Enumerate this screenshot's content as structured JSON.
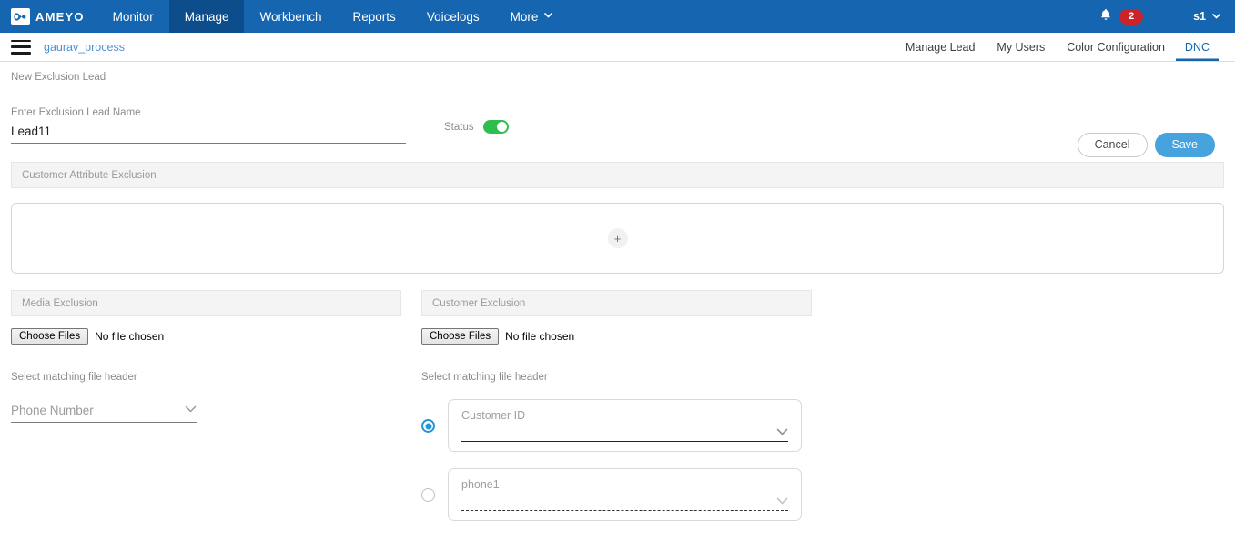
{
  "topnav": {
    "brand": "AMEYO",
    "brand_icon": "infinity-logo-icon",
    "items": [
      {
        "label": "Monitor",
        "active": false
      },
      {
        "label": "Manage",
        "active": true
      },
      {
        "label": "Workbench",
        "active": false
      },
      {
        "label": "Reports",
        "active": false
      },
      {
        "label": "Voicelogs",
        "active": false
      },
      {
        "label": "More",
        "active": false,
        "caret": "⌄"
      }
    ],
    "bell_icon": "notification-bell-icon",
    "notification_count": "2",
    "user": "s1",
    "user_caret": "⌄"
  },
  "subheader": {
    "menu_icon": "hamburger-menu-icon",
    "breadcrumb": "gaurav_process",
    "tabs": [
      {
        "label": "Manage Lead",
        "active": false
      },
      {
        "label": "My Users",
        "active": false
      },
      {
        "label": "Color Configuration",
        "active": false
      },
      {
        "label": "DNC",
        "active": true
      }
    ]
  },
  "page": {
    "title": "New Exclusion Lead",
    "cancel_label": "Cancel",
    "save_label": "Save"
  },
  "lead": {
    "label": "Enter Exclusion Lead Name",
    "value": "Lead11",
    "placeholder": "Enter Exclusion Lead Name",
    "status_label": "Status",
    "status_on": true
  },
  "attribute_section": {
    "header": "Customer Attribute Exclusion",
    "add_icon": "plus-icon",
    "add_label": "+"
  },
  "media": {
    "header": "Media Exclusion",
    "choose_files_label": "Choose Files",
    "file_status": "No file chosen",
    "matching_label": "Select matching file header",
    "selected_header": "Phone Number",
    "chevron": "⌄"
  },
  "customer": {
    "header": "Customer Exclusion",
    "choose_files_label": "Choose Files",
    "file_status": "No file chosen",
    "matching_label": "Select matching file header",
    "options": [
      {
        "placeholder": "Customer ID",
        "selected": true,
        "line": "solid"
      },
      {
        "placeholder": "phone1",
        "selected": false,
        "line": "dashed"
      }
    ],
    "chevron": "⌄"
  },
  "colors": {
    "nav_blue": "#1565b0",
    "nav_active_blue": "#0d4d8c",
    "badge_red": "#cc2229",
    "link_blue": "#4a90d9",
    "save_blue": "#46a3dd",
    "toggle_green": "#2fbd4f",
    "radio_blue": "#2196d6",
    "section_bg": "#f4f4f4"
  }
}
